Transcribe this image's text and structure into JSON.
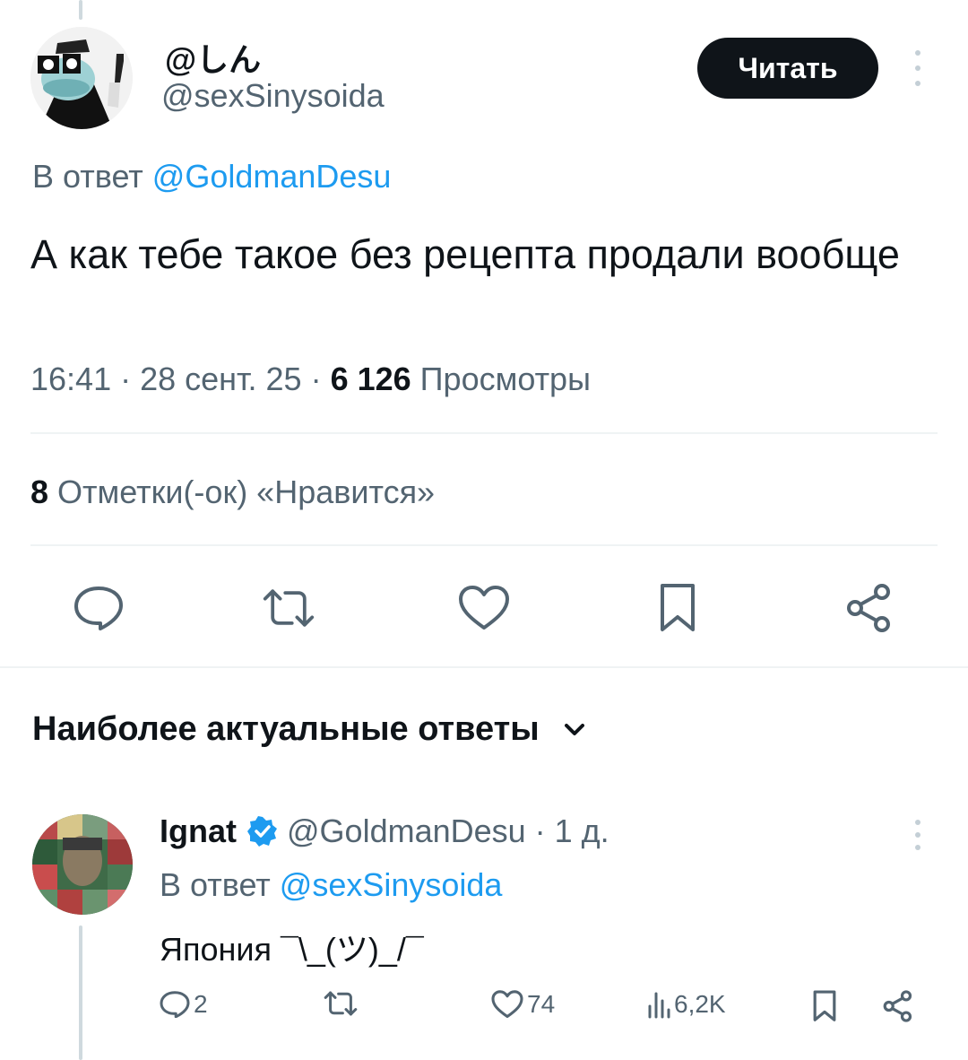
{
  "tweet": {
    "display_name": "@しん",
    "handle": "@sexSinysoida",
    "follow_label": "Читать",
    "reply_prefix": "В ответ",
    "reply_to": "@GoldmanDesu",
    "text": "А как тебе такое без рецепта продали вообще",
    "time": "16:41 · 28 сент. 25 · ",
    "views_count": "6 126",
    "views_label": " Просмотры",
    "likes_count": "8",
    "likes_label": " Отметки(-ок) «Нравится»"
  },
  "icons": {
    "reply": "comment-icon",
    "retweet": "retweet-icon",
    "like": "heart-icon",
    "bookmark": "bookmark-icon",
    "share": "share-icon",
    "more": "more-vertical-icon",
    "chevron": "chevron-down-icon",
    "verified": "verified-badge-icon",
    "views": "views-icon"
  },
  "replies_section": {
    "title": "Наиболее актуальные ответы"
  },
  "reply": {
    "name": "Ignat",
    "handle": "@GoldmanDesu · 1 д.",
    "reply_prefix": "В ответ",
    "reply_to": "@sexSinysoida",
    "text": "Япония ¯\\_(ツ)_/¯",
    "reply_count": "2",
    "like_count": "74",
    "views_count": "6,2K"
  },
  "colors": {
    "accent": "#1d9bf0",
    "text": "#0f1419",
    "secondary": "#536471",
    "divider": "#eff3f4"
  }
}
